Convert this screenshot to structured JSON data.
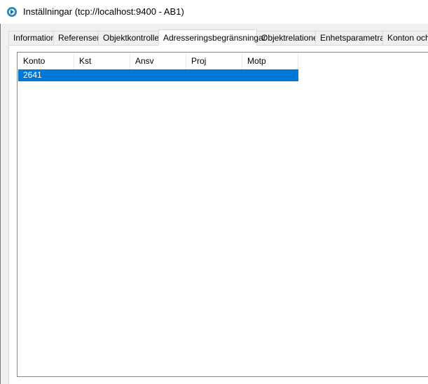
{
  "window": {
    "title": "Inställningar (tcp://localhost:9400 - AB1)",
    "icon": "app-logo-icon"
  },
  "tabs": [
    {
      "label": "Information",
      "active": false
    },
    {
      "label": "Referenser",
      "active": false
    },
    {
      "label": "Objektkontroller",
      "active": false
    },
    {
      "label": "Adresseringsbegränsningar",
      "active": true
    },
    {
      "label": "Objektrelationer",
      "active": false
    },
    {
      "label": "Enhetsparametrar",
      "active": false
    },
    {
      "label": "Konton och",
      "active": false
    }
  ],
  "table": {
    "columns": [
      "Konto",
      "Kst",
      "Ansv",
      "Proj",
      "Motp"
    ],
    "rows": [
      {
        "selected": true,
        "cells": [
          "2641",
          "",
          "",
          "",
          ""
        ]
      }
    ]
  },
  "colors": {
    "selection": "#0078d7",
    "tab_panel": "#ffffff",
    "window_bg": "#f0f0f0"
  }
}
